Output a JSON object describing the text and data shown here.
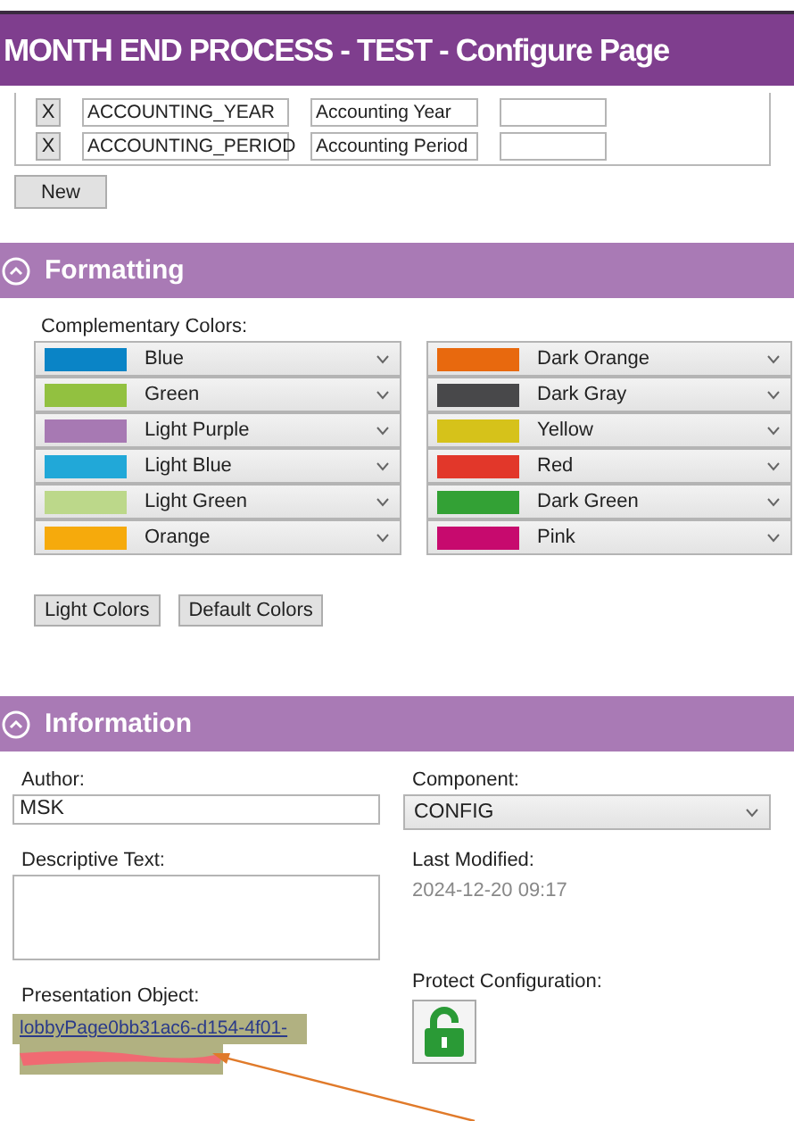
{
  "banner": {
    "title": "MONTH END PROCESS - TEST - Configure Page"
  },
  "parameters": {
    "rows": [
      {
        "remove": "X",
        "name": "ACCOUNTING_YEAR",
        "description": "Accounting Year",
        "value_field": ""
      },
      {
        "remove": "X",
        "name": "ACCOUNTING_PERIOD",
        "description": "Accounting Period",
        "value_field": ""
      }
    ],
    "new_button": "New"
  },
  "formatting": {
    "title": "Formatting",
    "expanded": true,
    "label": "Complementary Colors:",
    "colors": [
      {
        "label": "Blue",
        "color": "#0a84c6"
      },
      {
        "label": "Green",
        "color": "#92c140"
      },
      {
        "label": "Light Purple",
        "color": "#a779b3"
      },
      {
        "label": "Light Blue",
        "color": "#21a8d8"
      },
      {
        "label": "Light Green",
        "color": "#bcd88a"
      },
      {
        "label": "Orange",
        "color": "#f6aa0c"
      },
      {
        "label": "Dark Orange",
        "color": "#e8690e"
      },
      {
        "label": "Dark Gray",
        "color": "#48484a"
      },
      {
        "label": "Yellow",
        "color": "#d6c21a"
      },
      {
        "label": "Red",
        "color": "#e2372a"
      },
      {
        "label": "Dark Green",
        "color": "#33a135"
      },
      {
        "label": "Pink",
        "color": "#c70a6e"
      }
    ],
    "buttons": [
      "Light Colors",
      "Default Colors"
    ]
  },
  "information": {
    "title": "Information",
    "expanded": true,
    "author": {
      "label": "Author:",
      "value": "MSK"
    },
    "component": {
      "label": "Component:",
      "value": "CONFIG"
    },
    "descriptive_text": {
      "label": "Descriptive Text:"
    },
    "last_modified": {
      "label": "Last Modified:",
      "value": "2024-12-20 09:17"
    },
    "presentation_object": {
      "label": "Presentation Object:",
      "link": "lobbyPage0bb31ac6-d154-4f01-"
    },
    "protect_configuration": {
      "label": "Protect Configuration:",
      "locked": false
    }
  }
}
